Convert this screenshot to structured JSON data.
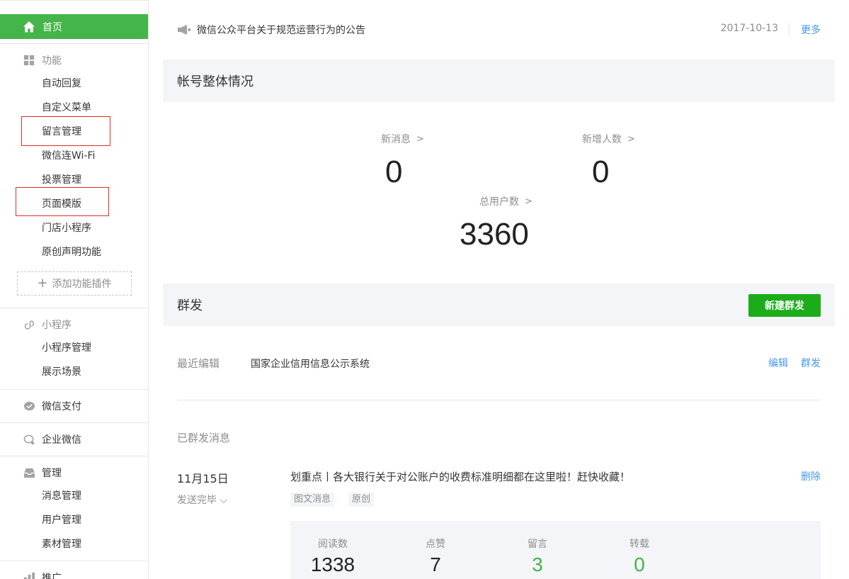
{
  "sidebar": {
    "home": "首页",
    "sections": {
      "features": "功能",
      "miniprogram": "小程序",
      "pay": "微信支付",
      "work": "企业微信",
      "manage": "管理",
      "promote": "推广"
    },
    "feature_items": [
      "自动回复",
      "自定义菜单",
      "留言管理",
      "微信连Wi-Fi",
      "投票管理",
      "页面模版",
      "门店小程序",
      "原创声明功能"
    ],
    "add_plugin": "添加功能插件",
    "mini_items": [
      "小程序管理",
      "展示场景"
    ],
    "manage_items": [
      "消息管理",
      "用户管理",
      "素材管理"
    ]
  },
  "notice": {
    "title": "微信公众平台关于规范运营行为的公告",
    "date": "2017-10-13",
    "more": "更多"
  },
  "account": {
    "heading": "帐号整体情况",
    "new_msg_label": "新消息",
    "new_msg_value": "0",
    "new_users_label": "新增人数",
    "new_users_value": "0",
    "total_users_label": "总用户数",
    "total_users_value": "3360"
  },
  "mass": {
    "heading": "群发",
    "new_button": "新建群发",
    "recent_label": "最近编辑",
    "recent_title": "国家企业信用信息公示系统",
    "edit": "编辑",
    "send": "群发",
    "sent_label": "已群发消息",
    "message": {
      "date": "11月15日",
      "status": "发送完毕",
      "title": "划重点丨各大银行关于对公账户的收费标准明细都在这里啦！赶快收藏！",
      "delete": "删除",
      "tags": [
        "图文消息",
        "原创"
      ],
      "metrics": [
        {
          "label": "阅读数",
          "value": "1338"
        },
        {
          "label": "点赞",
          "value": "7"
        },
        {
          "label": "留言",
          "value": "3"
        },
        {
          "label": "转载",
          "value": "0"
        }
      ]
    }
  },
  "colors": {
    "accent_green": "#44b549",
    "button_green": "#1aad19",
    "link_blue": "#459ae9",
    "highlight_red": "#e02e24"
  }
}
